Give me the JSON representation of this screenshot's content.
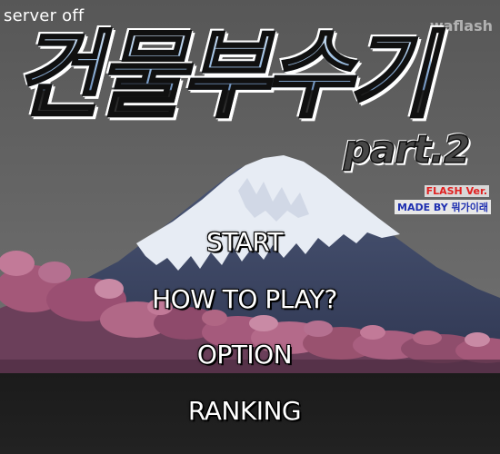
{
  "header": {
    "server_status": "server off",
    "publisher": "waflash"
  },
  "title": {
    "main": "건물부수기",
    "part": "part.2",
    "flash_version": "FLASH Ver.",
    "made_by": "MADE BY 뭐가이래"
  },
  "menu": {
    "start": "START",
    "how_to_play": "HOW TO PLAY?",
    "option": "OPTION",
    "ranking": "RANKING"
  },
  "colors": {
    "sky": "#6d6d6d",
    "mountain": "#3f4a6a",
    "snow": "#e6ebf3",
    "blossom": "#a8587a",
    "bottom_bar": "#161616",
    "title_fill": "#9ec0e4",
    "menu_text": "#ffffff"
  }
}
